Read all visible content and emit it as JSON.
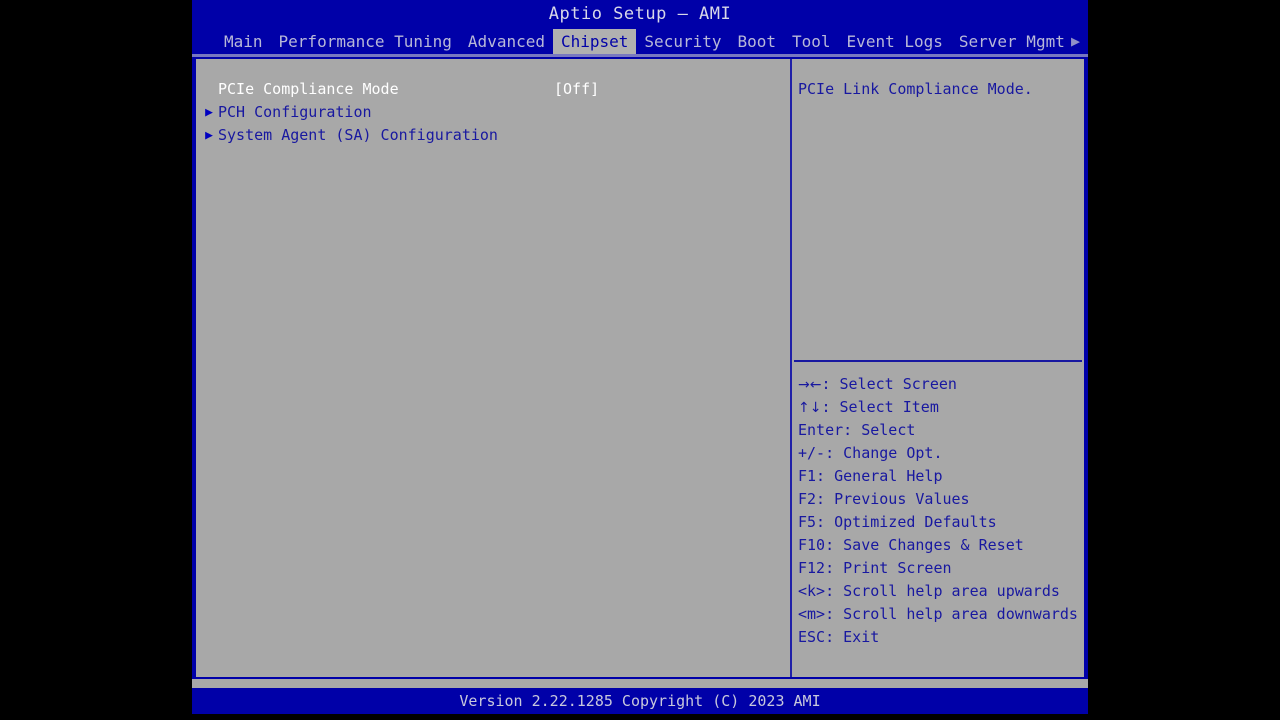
{
  "window": {
    "title": "Aptio Setup – AMI"
  },
  "menu": {
    "tabs": [
      {
        "label": "Main",
        "active": false
      },
      {
        "label": "Performance Tuning",
        "active": false
      },
      {
        "label": "Advanced",
        "active": false
      },
      {
        "label": "Chipset",
        "active": true
      },
      {
        "label": "Security",
        "active": false
      },
      {
        "label": "Boot",
        "active": false
      },
      {
        "label": "Tool",
        "active": false
      },
      {
        "label": "Event Logs",
        "active": false
      },
      {
        "label": "Server Mgmt",
        "active": false
      }
    ],
    "more_arrow": "▶"
  },
  "settings": {
    "rows": [
      {
        "label": "PCIe Compliance Mode",
        "value": "[Off]",
        "arrow": "",
        "selected": true
      },
      {
        "label": "PCH Configuration",
        "value": "",
        "arrow": "▶",
        "selected": false
      },
      {
        "label": "System Agent (SA) Configuration",
        "value": "",
        "arrow": "▶",
        "selected": false
      }
    ]
  },
  "help": {
    "text": "PCIe Link Compliance Mode.",
    "legend": [
      {
        "key": "→←",
        "text": ": Select Screen"
      },
      {
        "key": "↑↓",
        "text": ": Select Item"
      },
      {
        "key": "",
        "text": "Enter: Select"
      },
      {
        "key": "",
        "text": "+/-: Change Opt."
      },
      {
        "key": "",
        "text": "F1: General Help"
      },
      {
        "key": "",
        "text": "F2: Previous Values"
      },
      {
        "key": "",
        "text": "F5: Optimized Defaults"
      },
      {
        "key": "",
        "text": "F10: Save Changes & Reset"
      },
      {
        "key": "",
        "text": "F12: Print Screen"
      },
      {
        "key": "",
        "text": "<k>: Scroll help area upwards"
      },
      {
        "key": "",
        "text": "<m>: Scroll help area downwards"
      },
      {
        "key": "",
        "text": "ESC: Exit"
      }
    ]
  },
  "footer": {
    "version": "Version 2.22.1285 Copyright (C) 2023 AMI"
  },
  "colors": {
    "bios_blue": "#0000a8",
    "panel_gray": "#a8a8a8",
    "text_blue": "#1818a0",
    "selected_white": "#ffffff",
    "tab_active_bg": "#b0b0b0"
  }
}
